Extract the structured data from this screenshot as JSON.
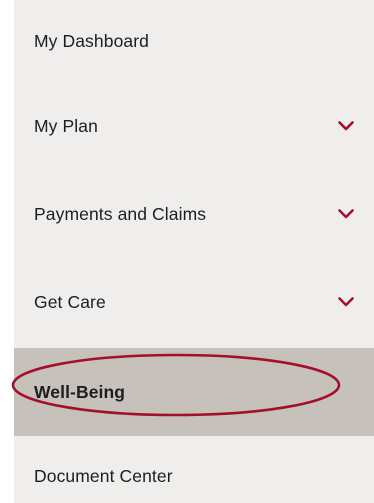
{
  "nav": {
    "items": [
      {
        "label": "My Dashboard",
        "has_chevron": false,
        "active": false
      },
      {
        "label": "My Plan",
        "has_chevron": true,
        "active": false
      },
      {
        "label": "Payments and Claims",
        "has_chevron": true,
        "active": false
      },
      {
        "label": "Get Care",
        "has_chevron": true,
        "active": false
      },
      {
        "label": "Well-Being",
        "has_chevron": false,
        "active": true
      },
      {
        "label": "Document Center",
        "has_chevron": false,
        "active": false
      }
    ]
  },
  "colors": {
    "panel_bg": "#efeeec",
    "active_bg": "#c6c1bb",
    "chevron": "#a3102c",
    "highlight_ring": "#a3102c",
    "text": "#1e1e1e"
  },
  "icons": {
    "chevron": "chevron-down-icon"
  }
}
